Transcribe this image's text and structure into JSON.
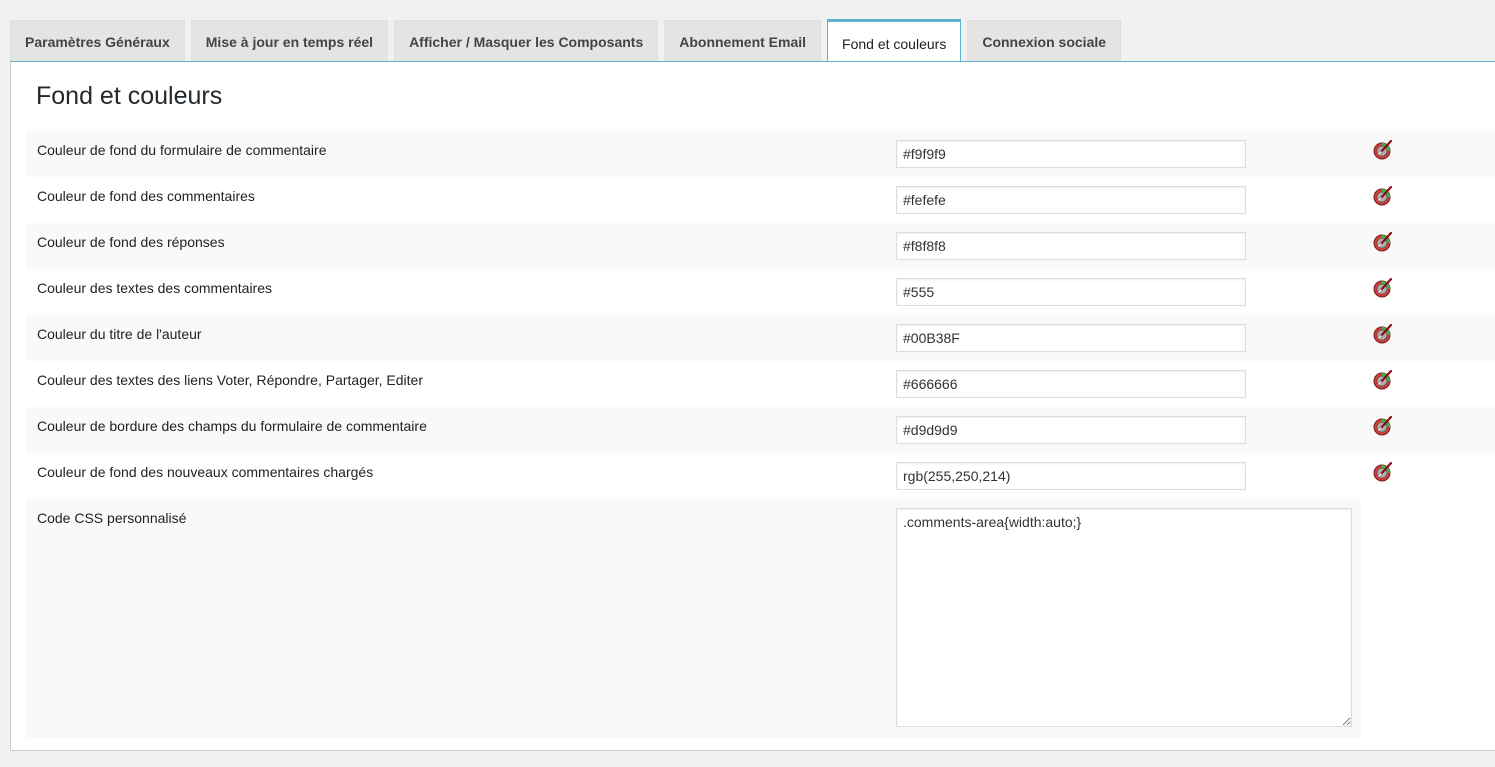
{
  "tabs": [
    {
      "label": "Paramètres Généraux",
      "active": false
    },
    {
      "label": "Mise à jour en temps réel",
      "active": false
    },
    {
      "label": "Afficher / Masquer les Composants",
      "active": false
    },
    {
      "label": "Abonnement Email",
      "active": false
    },
    {
      "label": "Fond et couleurs",
      "active": true
    },
    {
      "label": "Connexion sociale",
      "active": false
    }
  ],
  "section": {
    "title": "Fond et couleurs"
  },
  "color_settings": [
    {
      "label": "Couleur de fond du formulaire de commentaire",
      "value": "#f9f9f9"
    },
    {
      "label": "Couleur de fond des commentaires",
      "value": "#fefefe"
    },
    {
      "label": "Couleur de fond des réponses",
      "value": "#f8f8f8"
    },
    {
      "label": "Couleur des textes des commentaires",
      "value": "#555"
    },
    {
      "label": "Couleur du titre de l'auteur",
      "value": "#00B38F"
    },
    {
      "label": "Couleur des textes des liens Voter, Répondre, Partager, Editer",
      "value": "#666666"
    },
    {
      "label": "Couleur de bordure des champs du formulaire de commentaire",
      "value": "#d9d9d9"
    },
    {
      "label": "Couleur de fond des nouveaux commentaires chargés",
      "value": "rgb(255,250,214)"
    }
  ],
  "custom_css": {
    "label": "Code CSS personnalisé",
    "value": ".comments-area{width:auto;}"
  },
  "picker_icon": "color-picker-icon",
  "colors": {
    "accent": "#5fb0c9",
    "stripe": "#f9f9f9",
    "picker_red": "#d63a3a",
    "picker_green": "#43b649"
  }
}
